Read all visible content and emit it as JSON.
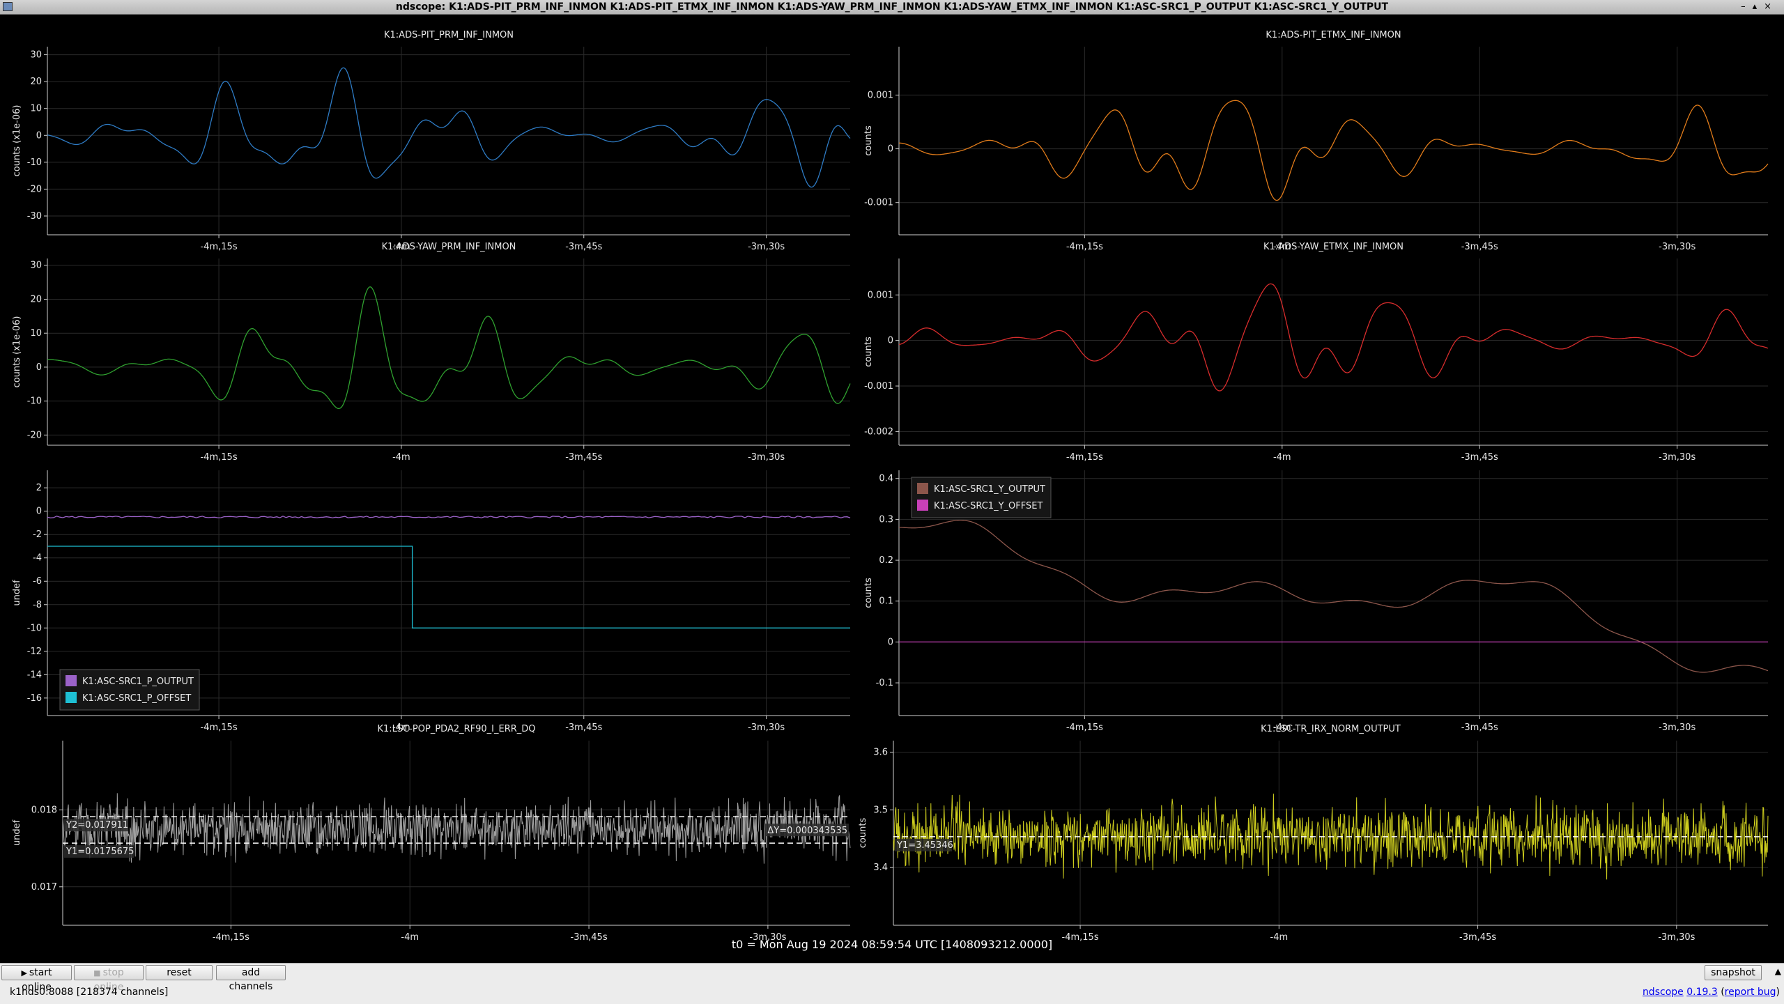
{
  "window": {
    "title": "ndscope: K1:ADS-PIT_PRM_INF_INMON K1:ADS-PIT_ETMX_INF_INMON K1:ADS-YAW_PRM_INF_INMON K1:ADS-YAW_ETMX_INF_INMON K1:ASC-SRC1_P_OUTPUT K1:ASC-SRC1_Y_OUTPUT"
  },
  "t0_label": "t0 = Mon Aug 19 2024 08:59:54 UTC [1408093212.0000]",
  "time_ticks": [
    "-4m,15s",
    "-4m",
    "-3m,45s",
    "-3m,30s"
  ],
  "chart_data": [
    {
      "id": "p1",
      "type": "line",
      "title": "K1:ADS-PIT_PRM_INF_INMON",
      "ylabel": "counts (x1e-06)",
      "y_ticks": [
        "30",
        "20",
        "10",
        "0",
        "-10",
        "-20",
        "-30"
      ],
      "ylim": [
        -37,
        33
      ],
      "xlim": [
        -280,
        -192
      ],
      "series": [
        {
          "name": "K1:ADS-PIT_PRM_INF_INMON",
          "color": "#2e7bc4",
          "style": "wave",
          "amplitude": 27,
          "seed": 1
        }
      ]
    },
    {
      "id": "p2",
      "type": "line",
      "title": "K1:ADS-PIT_ETMX_INF_INMON",
      "ylabel": "counts",
      "y_ticks": [
        "0.001",
        "0",
        "-0.001"
      ],
      "ylim": [
        -0.0016,
        0.0019
      ],
      "xlim": [
        -280,
        -192
      ],
      "series": [
        {
          "name": "K1:ADS-PIT_ETMX_INF_INMON",
          "color": "#e07b1a",
          "style": "wave",
          "amplitude": 0.0013,
          "seed": 2
        }
      ]
    },
    {
      "id": "p3",
      "type": "line",
      "title": "K1:ADS-YAW_PRM_INF_INMON",
      "ylabel": "counts (x1e-06)",
      "y_ticks": [
        "30",
        "20",
        "10",
        "0",
        "-10",
        "-20"
      ],
      "ylim": [
        -23,
        32
      ],
      "xlim": [
        -280,
        -192
      ],
      "series": [
        {
          "name": "K1:ADS-YAW_PRM_INF_INMON",
          "color": "#2fa02f",
          "style": "wave",
          "amplitude": 24,
          "seed": 3
        }
      ]
    },
    {
      "id": "p4",
      "type": "line",
      "title": "K1:ADS-YAW_ETMX_INF_INMON",
      "ylabel": "counts",
      "y_ticks": [
        "0.001",
        "0",
        "-0.001",
        "-0.002"
      ],
      "ylim": [
        -0.0023,
        0.0018
      ],
      "xlim": [
        -280,
        -192
      ],
      "series": [
        {
          "name": "K1:ADS-YAW_ETMX_INF_INMON",
          "color": "#d62c2c",
          "style": "wave",
          "amplitude": 0.0016,
          "seed": 4
        }
      ]
    },
    {
      "id": "p5",
      "type": "line",
      "title": "",
      "ylabel": "undef",
      "y_ticks": [
        "2",
        "0",
        "-2",
        "-4",
        "-6",
        "-8",
        "-10",
        "-12",
        "-14",
        "-16"
      ],
      "ylim": [
        -17.5,
        3.5
      ],
      "xlim": [
        -280,
        -192
      ],
      "legend_position": "bottom-left",
      "series": [
        {
          "name": "K1:ASC-SRC1_P_OUTPUT",
          "color": "#9b62c8",
          "style": "flat",
          "level": -0.5,
          "amplitude": 0.15,
          "seed": 5
        },
        {
          "name": "K1:ASC-SRC1_P_OFFSET",
          "color": "#1ec0d4",
          "style": "step",
          "before": -3,
          "after": -10,
          "step_x": -240
        }
      ]
    },
    {
      "id": "p6",
      "type": "line",
      "title": "",
      "ylabel": "counts",
      "y_ticks": [
        "0.4",
        "0.3",
        "0.2",
        "0.1",
        "0",
        "-0.1"
      ],
      "ylim": [
        -0.18,
        0.42
      ],
      "xlim": [
        -280,
        -192
      ],
      "legend_position": "top-left",
      "series": [
        {
          "name": "K1:ASC-SRC1_Y_OUTPUT",
          "color": "#8c564b",
          "style": "drift",
          "amplitude": 0.3,
          "seed": 6
        },
        {
          "name": "K1:ASC-SRC1_Y_OFFSET",
          "color": "#c840b8",
          "style": "flat",
          "level": 0,
          "amplitude": 0,
          "seed": 7
        }
      ]
    },
    {
      "id": "p7",
      "type": "line",
      "title": "K1:LSC-POP_PDA2_RF90_I_ERR_DQ",
      "ylabel": "undef",
      "y_ticks": [
        "0.018",
        "0.017"
      ],
      "ylim": [
        0.0165,
        0.0189
      ],
      "xlim": [
        -280,
        -192
      ],
      "cursors": {
        "y2": "Y2=0.017911",
        "y1": "Y1=0.0175675",
        "dy": "ΔY=0.000343535",
        "y2_value": 0.017911,
        "y1_value": 0.0175675
      },
      "series": [
        {
          "name": "K1:LSC-POP_PDA2_RF90_I_ERR_DQ",
          "color": "#a8a8a8",
          "style": "noise",
          "center": 0.01775,
          "amplitude": 0.0005,
          "seed": 8
        }
      ]
    },
    {
      "id": "p8",
      "type": "line",
      "title": "K1:LSC-TR_IRX_NORM_OUTPUT",
      "ylabel": "counts",
      "y_ticks": [
        "3.6",
        "3.5",
        "3.4"
      ],
      "ylim": [
        3.3,
        3.62
      ],
      "xlim": [
        -280,
        -192
      ],
      "cursors": {
        "y1": "Y1=3.45346",
        "y1_value": 3.45346
      },
      "series": [
        {
          "name": "K1:LSC-TR_IRX_NORM_OUTPUT",
          "color": "#d8d820",
          "style": "noise",
          "center": 3.455,
          "amplitude": 0.08,
          "seed": 9
        }
      ]
    }
  ],
  "toolbar": {
    "start_online": "start online",
    "stop_online": "stop online",
    "reset": "reset",
    "add_channels": "add channels",
    "snapshot": "snapshot"
  },
  "status": {
    "server": "k1nds0:8088  [218374 channels]",
    "app_name": "ndscope",
    "version": "0.19.3",
    "report_bug": "report bug"
  }
}
